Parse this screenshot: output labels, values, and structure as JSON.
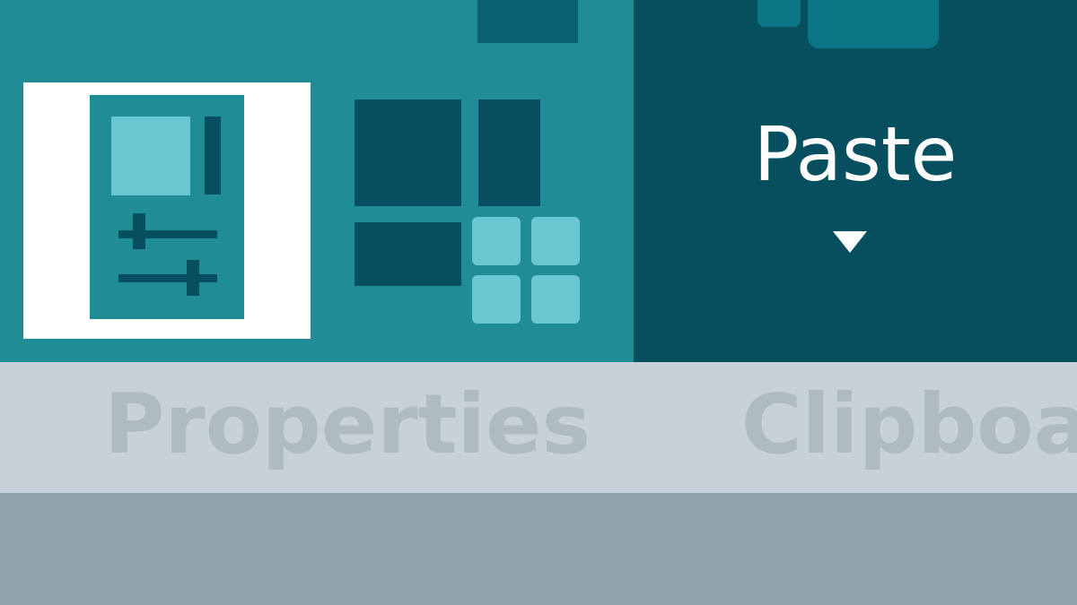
{
  "ribbon": {
    "properties_group": {
      "label": "Properties",
      "icon": "properties-panel-icon",
      "layout_icon": "layout-grid-icon"
    },
    "clipboard_group": {
      "label": "Clipboard",
      "paste_label": "Paste",
      "paste_icon": "caret-down-icon"
    }
  },
  "colors": {
    "ribbon_teal": "#1f8c96",
    "ribbon_dark": "#064f5e",
    "accent_light": "#6ac7cf",
    "label_bar": "#c7d1d8",
    "label_text": "#aebbc3",
    "lower_pane": "#90a3ad"
  }
}
